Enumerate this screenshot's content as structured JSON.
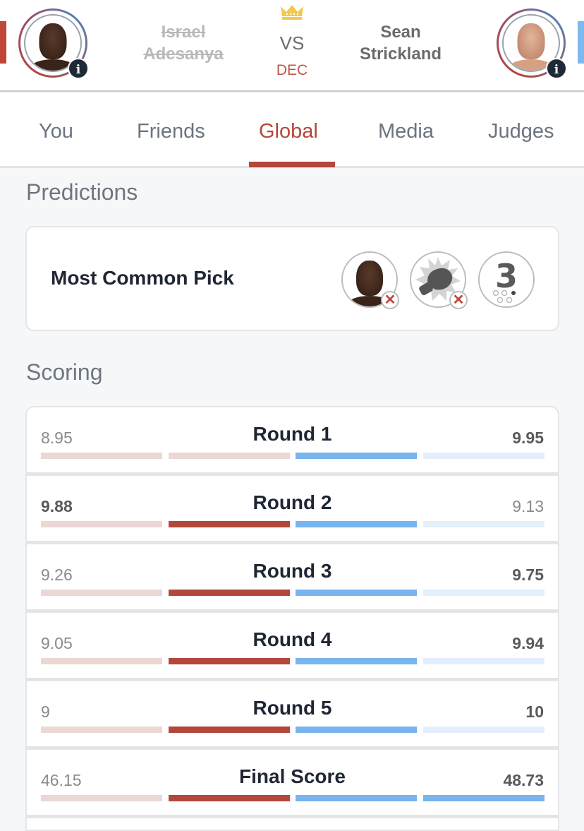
{
  "header": {
    "red_fighter": {
      "name_line1": "Israel",
      "name_line2": "Adesanya",
      "status": "loser",
      "info_label": "i"
    },
    "blue_fighter": {
      "name_line1": "Sean",
      "name_line2": "Strickland",
      "status": "winner",
      "info_label": "i"
    },
    "vs_label": "VS",
    "method": "DEC",
    "winner_icon": "crown-icon"
  },
  "tabs": [
    {
      "label": "You",
      "active": false
    },
    {
      "label": "Friends",
      "active": false
    },
    {
      "label": "Global",
      "active": true
    },
    {
      "label": "Media",
      "active": false
    },
    {
      "label": "Judges",
      "active": false
    }
  ],
  "predictions": {
    "title": "Predictions",
    "most_common_pick": {
      "label": "Most Common Pick",
      "picks": [
        {
          "type": "fighter",
          "value": "Israel Adesanya",
          "icon": "fighter-avatar-icon",
          "result": "incorrect"
        },
        {
          "type": "method",
          "value": "KO/TKO",
          "icon": "punch-glove-icon",
          "result": "incorrect"
        },
        {
          "type": "round",
          "value": "3",
          "icon": "round-number-icon",
          "result": "none"
        }
      ]
    }
  },
  "scoring": {
    "title": "Scoring",
    "colors": {
      "red_dark": "#b3473c",
      "red_light": "#ecd7d5",
      "blue_dark": "#78b4ee",
      "blue_light": "#e3effb"
    },
    "rows": [
      {
        "label": "Round 1",
        "red": "8.95",
        "blue": "9.95",
        "winner": "blue",
        "red_filled": 0,
        "blue_filled": 1
      },
      {
        "label": "Round 2",
        "red": "9.88",
        "blue": "9.13",
        "winner": "red",
        "red_filled": 1,
        "blue_filled": 1
      },
      {
        "label": "Round 3",
        "red": "9.26",
        "blue": "9.75",
        "winner": "blue",
        "red_filled": 1,
        "blue_filled": 1
      },
      {
        "label": "Round 4",
        "red": "9.05",
        "blue": "9.94",
        "winner": "blue",
        "red_filled": 1,
        "blue_filled": 1
      },
      {
        "label": "Round 5",
        "red": "9",
        "blue": "10",
        "winner": "blue",
        "red_filled": 1,
        "blue_filled": 1
      },
      {
        "label": "Final Score",
        "red": "46.15",
        "blue": "48.73",
        "winner": "blue",
        "red_filled": 1,
        "blue_filled": 2
      }
    ]
  }
}
